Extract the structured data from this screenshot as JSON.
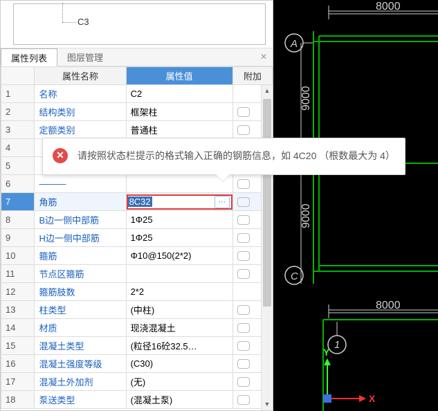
{
  "tree": {
    "node": "C3"
  },
  "tabs": {
    "props": "属性列表",
    "layers": "图层管理"
  },
  "header": {
    "name": "属性名称",
    "value": "属性值",
    "extra": "附加"
  },
  "rows": [
    {
      "n": "1",
      "name": "名称",
      "val": "C2",
      "link": true,
      "ext": false
    },
    {
      "n": "2",
      "name": "结构类别",
      "val": "框架柱",
      "link": true,
      "ext": true
    },
    {
      "n": "3",
      "name": "定额类别",
      "val": "普通柱",
      "link": true,
      "ext": true
    },
    {
      "n": "4",
      "name": "",
      "val": "",
      "link": true,
      "ext": true,
      "hidden": true
    },
    {
      "n": "5",
      "name": "",
      "val": "",
      "link": true,
      "ext": true,
      "hidden": true
    },
    {
      "n": "6",
      "name": "",
      "val": "",
      "link": true,
      "ext": true,
      "hidden": true,
      "strike": true
    },
    {
      "n": "7",
      "name": "角筋",
      "val": "8C32",
      "link": true,
      "ext": true,
      "selected": true,
      "edit": true
    },
    {
      "n": "8",
      "name": "B边一侧中部筋",
      "val": "1Φ25",
      "link": true,
      "ext": true
    },
    {
      "n": "9",
      "name": "H边一侧中部筋",
      "val": "1Φ25",
      "link": true,
      "ext": true
    },
    {
      "n": "10",
      "name": "箍筋",
      "val": "Φ10@150(2*2)",
      "link": true,
      "ext": true
    },
    {
      "n": "11",
      "name": "节点区箍筋",
      "val": "",
      "link": true,
      "ext": true
    },
    {
      "n": "12",
      "name": "箍筋肢数",
      "val": "2*2",
      "link": true,
      "ext": false
    },
    {
      "n": "13",
      "name": "柱类型",
      "val": "(中柱)",
      "link": true,
      "ext": true
    },
    {
      "n": "14",
      "name": "材质",
      "val": "现浇混凝土",
      "link": true,
      "ext": true
    },
    {
      "n": "15",
      "name": "混凝土类型",
      "val": "(粒径16砼32.5…",
      "link": true,
      "ext": true
    },
    {
      "n": "16",
      "name": "混凝土强度等级",
      "val": "(C30)",
      "link": true,
      "ext": true
    },
    {
      "n": "17",
      "name": "混凝土外加剂",
      "val": "(无)",
      "link": true,
      "ext": true
    },
    {
      "n": "18",
      "name": "泵送类型",
      "val": "(混凝土泵)",
      "link": true,
      "ext": true
    }
  ],
  "tooltip": {
    "text": "请按照状态栏提示的格式输入正确的钢筋信息，如 4C20 （根数最大为 4）"
  },
  "cad": {
    "dim_top": "8000",
    "dim_bottom": "8000",
    "vdim1": "9000",
    "vdim2": "9000",
    "label_a": "A",
    "label_c": "C",
    "label_1": "1",
    "axis_x": "X",
    "axis_y": "Y"
  }
}
